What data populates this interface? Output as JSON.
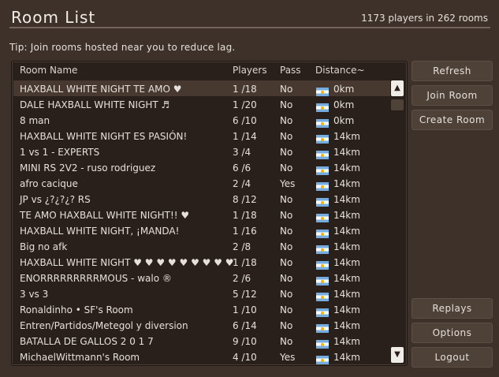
{
  "header": {
    "title": "Room List",
    "count": "1173 players in 262 rooms"
  },
  "tip": "Tip: Join rooms hosted near you to reduce lag.",
  "columns": {
    "name": "Room Name",
    "players": "Players",
    "pass": "Pass",
    "distance": "Distance~"
  },
  "rooms": [
    {
      "name": "HAXBALL WHITE NIGHT TE AMO ♥",
      "players": "1 /18",
      "pass": "No",
      "distance": "0km",
      "flag": "argentina-flag-icon"
    },
    {
      "name": "DALE HAXBALL WHITE NIGHT ♬",
      "players": "1 /20",
      "pass": "No",
      "distance": "0km",
      "flag": "argentina-flag-icon"
    },
    {
      "name": "8 man",
      "players": "6 /10",
      "pass": "No",
      "distance": "0km",
      "flag": "argentina-flag-icon"
    },
    {
      "name": "HAXBALL WHITE NIGHT ES PASIÓN!",
      "players": "1 /14",
      "pass": "No",
      "distance": "14km",
      "flag": "argentina-flag-icon"
    },
    {
      "name": "1 vs 1 -                  EXPERTS",
      "players": "3 /4",
      "pass": "No",
      "distance": "14km",
      "flag": "argentina-flag-icon"
    },
    {
      "name": "MINI RS 2V2 - ruso rodriguez",
      "players": "6 /6",
      "pass": "No",
      "distance": "14km",
      "flag": "argentina-flag-icon"
    },
    {
      "name": "afro cacique",
      "players": "2 /4",
      "pass": "Yes",
      "distance": "14km",
      "flag": "argentina-flag-icon"
    },
    {
      "name": "JP vs ¿?¿?¿? RS",
      "players": "8 /12",
      "pass": "No",
      "distance": "14km",
      "flag": "argentina-flag-icon"
    },
    {
      "name": "TE AMO HAXBALL WHITE NIGHT!! ♥",
      "players": "1 /18",
      "pass": "No",
      "distance": "14km",
      "flag": "argentina-flag-icon"
    },
    {
      "name": "HAXBALL WHITE NIGHT, ¡MANDA!",
      "players": "1 /16",
      "pass": "No",
      "distance": "14km",
      "flag": "argentina-flag-icon"
    },
    {
      "name": "Big no afk",
      "players": "2 /8",
      "pass": "No",
      "distance": "14km",
      "flag": "argentina-flag-icon"
    },
    {
      "name": "HAXBALL WHITE NIGHT ♥ ♥ ♥ ♥ ♥ ♥ ♥ ♥ ♥",
      "players": "1 /18",
      "pass": "No",
      "distance": "14km",
      "flag": "argentina-flag-icon"
    },
    {
      "name": "ENORRRRRRRRRMOUS - walo ®",
      "players": "2 /6",
      "pass": "No",
      "distance": "14km",
      "flag": "argentina-flag-icon"
    },
    {
      "name": "3 vs 3",
      "players": "5 /12",
      "pass": "No",
      "distance": "14km",
      "flag": "argentina-flag-icon"
    },
    {
      "name": "Ronaldinho • SF's Room",
      "players": "1 /10",
      "pass": "No",
      "distance": "14km",
      "flag": "argentina-flag-icon"
    },
    {
      "name": "Entren/Partidos/Metegol y diversion",
      "players": "6 /14",
      "pass": "No",
      "distance": "14km",
      "flag": "argentina-flag-icon"
    },
    {
      "name": "BATALLA DE GALLOS 2 0 1 7",
      "players": "9 /10",
      "pass": "No",
      "distance": "14km",
      "flag": "argentina-flag-icon"
    },
    {
      "name": "MichaelWittmann's Room",
      "players": "4 /10",
      "pass": "Yes",
      "distance": "14km",
      "flag": "argentina-flag-icon"
    }
  ],
  "scroll": {
    "up": "▲",
    "down": "▼"
  },
  "buttons": {
    "refresh": "Refresh",
    "join": "Join Room",
    "create": "Create Room",
    "replays": "Replays",
    "options": "Options",
    "logout": "Logout"
  }
}
